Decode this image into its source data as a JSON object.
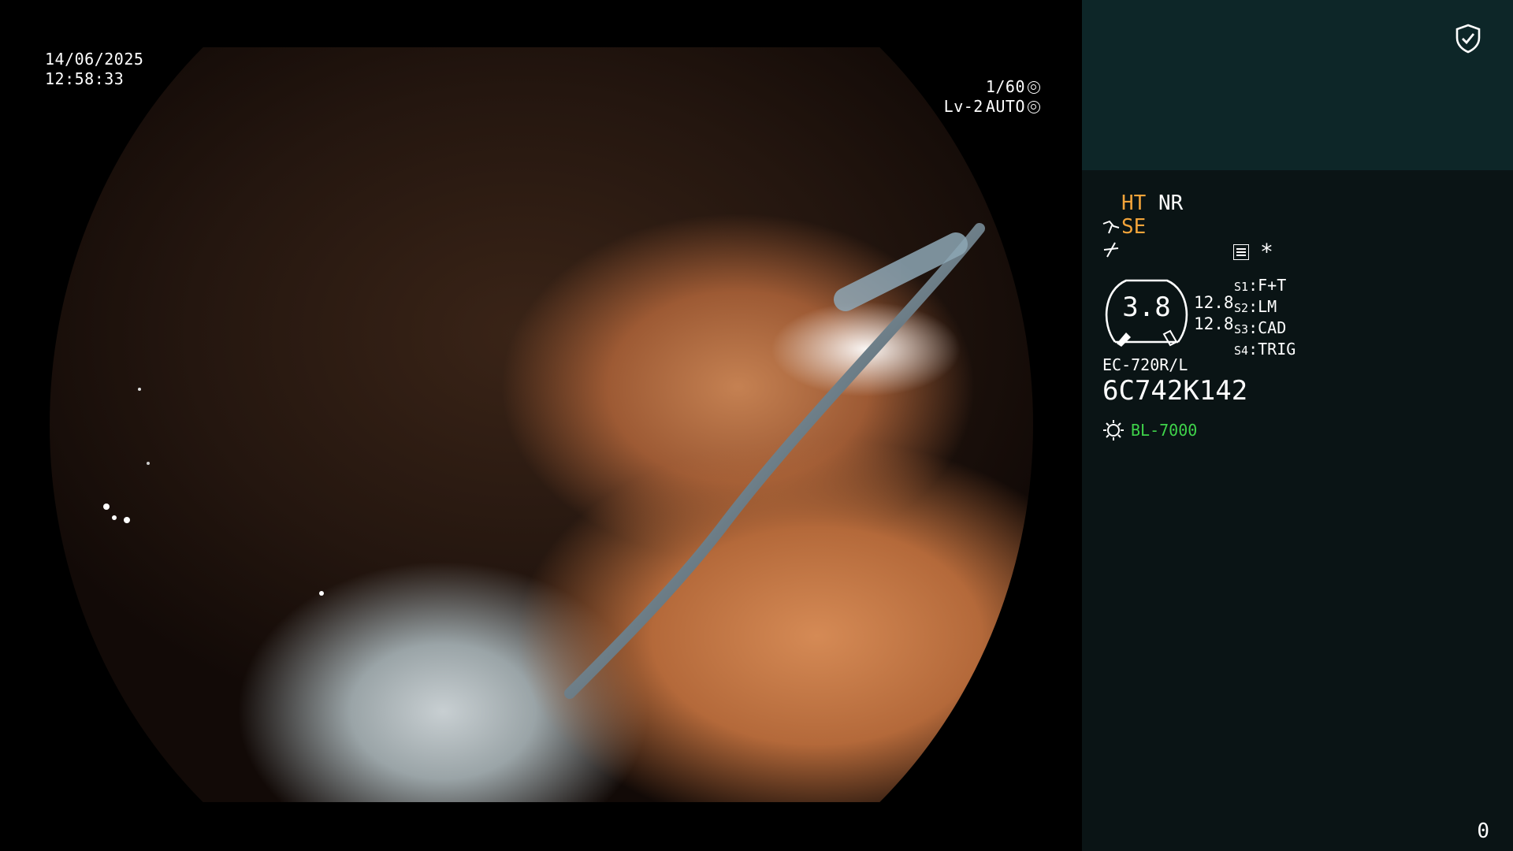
{
  "video": {
    "date": "14/06/2025",
    "time": "12:58:33",
    "shutter": "1/60",
    "level": "Lv-2",
    "mode": "AUTO"
  },
  "panel": {
    "shield_icon": "shield-check-icon",
    "ht": "HT",
    "nr": "NR",
    "se": "SE",
    "cut_icon": "pulse-icon",
    "menu_icon": "menu-settings-icon",
    "star": "*",
    "dial_value": "3.8",
    "dial_right_top": "12.8",
    "dial_right_bottom": "12.8",
    "slots": [
      {
        "key": "S1",
        "value": "F+T"
      },
      {
        "key": "S2",
        "value": "LM"
      },
      {
        "key": "S3",
        "value": "CAD"
      },
      {
        "key": "S4",
        "value": "TRIG"
      }
    ],
    "scope_model": "EC-720R/L",
    "serial": "6C742K142",
    "light_source": "BL-7000",
    "light_icon": "light-sun-icon",
    "counter": "0"
  },
  "colors": {
    "accent_orange": "#f3a43a",
    "accent_green": "#3fd34a",
    "panel_top": "#0d2628",
    "panel_bg": "#0a1415"
  }
}
